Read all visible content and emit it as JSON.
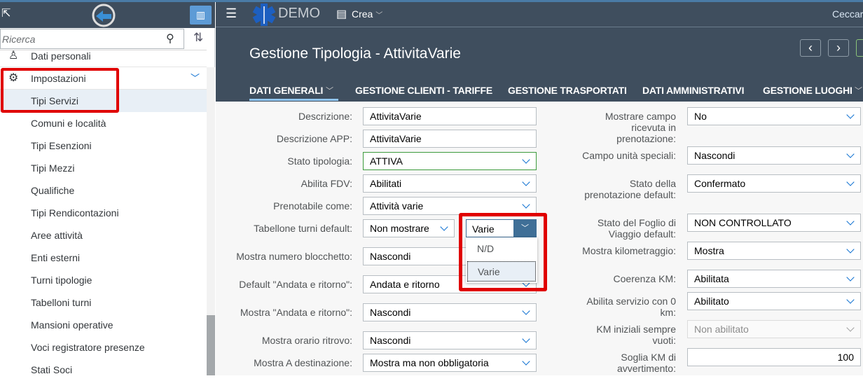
{
  "shell": {
    "app_name": "DEMO",
    "create_label": "Crea",
    "user": "Ceccar"
  },
  "sidebar": {
    "search_placeholder": "Ricerca",
    "items": [
      "Dati personali",
      "Impostazioni",
      "Tipi Servizi",
      "Comuni e località",
      "Tipi Esenzioni",
      "Tipi Mezzi",
      "Qualifiche",
      "Tipi Rendicontazioni",
      "Aree attività",
      "Enti esterni",
      "Turni tipologie",
      "Tabelloni turni",
      "Mansioni operative",
      "Voci registratore presenze",
      "Stati Soci"
    ]
  },
  "page": {
    "title": "Gestione Tipologia - AttivitaVarie"
  },
  "tabs": [
    "DATI GENERALI",
    "GESTIONE CLIENTI - TARIFFE",
    "GESTIONE TRASPORTATI",
    "DATI AMMINISTRATIVI",
    "GESTIONE LUOGHI"
  ],
  "form_left": [
    {
      "label": "Descrizione:",
      "value": "AttivitaVarie",
      "type": "text"
    },
    {
      "label": "Descrizione APP:",
      "value": "AttivitaVarie",
      "type": "text"
    },
    {
      "label": "Stato tipologia:",
      "value": "ATTIVA",
      "type": "select"
    },
    {
      "label": "Abilita FDV:",
      "value": "Abilitati",
      "type": "select"
    },
    {
      "label": "Prenotabile come:",
      "value": "Attività varie",
      "type": "select"
    },
    {
      "label": "Tabellone turni default:",
      "value": "Non mostrare",
      "type": "select"
    },
    {
      "label": "Mostra numero blocchetto:",
      "value": "Nascondi",
      "type": "select"
    },
    {
      "label": "Default \"Andata e ritorno\":",
      "value": "Andata e ritorno",
      "type": "select"
    },
    {
      "label": "Mostra \"Andata e ritorno\":",
      "value": "Nascondi",
      "type": "select"
    },
    {
      "label": "Mostra orario ritrovo:",
      "value": "Nascondi",
      "type": "select"
    },
    {
      "label": "Mostra A destinazione:",
      "value": "Mostra ma non obbligatoria",
      "type": "select"
    }
  ],
  "form_right": [
    {
      "label": "Mostrare campo ricevuta in prenotazione:",
      "value": "No",
      "type": "select"
    },
    {
      "label": "Campo unità speciali:",
      "value": "Nascondi",
      "type": "select"
    },
    {
      "label": "Stato della prenotazione default:",
      "value": "Confermato",
      "type": "select"
    },
    {
      "label": "Stato del Foglio di Viaggio default:",
      "value": "NON CONTROLLATO",
      "type": "select"
    },
    {
      "label": "Mostra kilometraggio:",
      "value": "Mostra",
      "type": "select"
    },
    {
      "label": "Coerenza KM:",
      "value": "Abilitata",
      "type": "select"
    },
    {
      "label": "Abilita servizio con 0 km:",
      "value": "Abilitato",
      "type": "select"
    },
    {
      "label": "KM iniziali sempre vuoti:",
      "value": "Non abilitato",
      "type": "disabled"
    },
    {
      "label": "Soglia KM di avvertimento:",
      "value": "100",
      "type": "number"
    }
  ],
  "tabellone_dropdown": {
    "value": "Varie",
    "options": [
      "N/D",
      "Varie"
    ]
  },
  "colors": {
    "shell": "#3f4e5e",
    "highlight": "#e00000",
    "accent": "#0a6ed1"
  }
}
